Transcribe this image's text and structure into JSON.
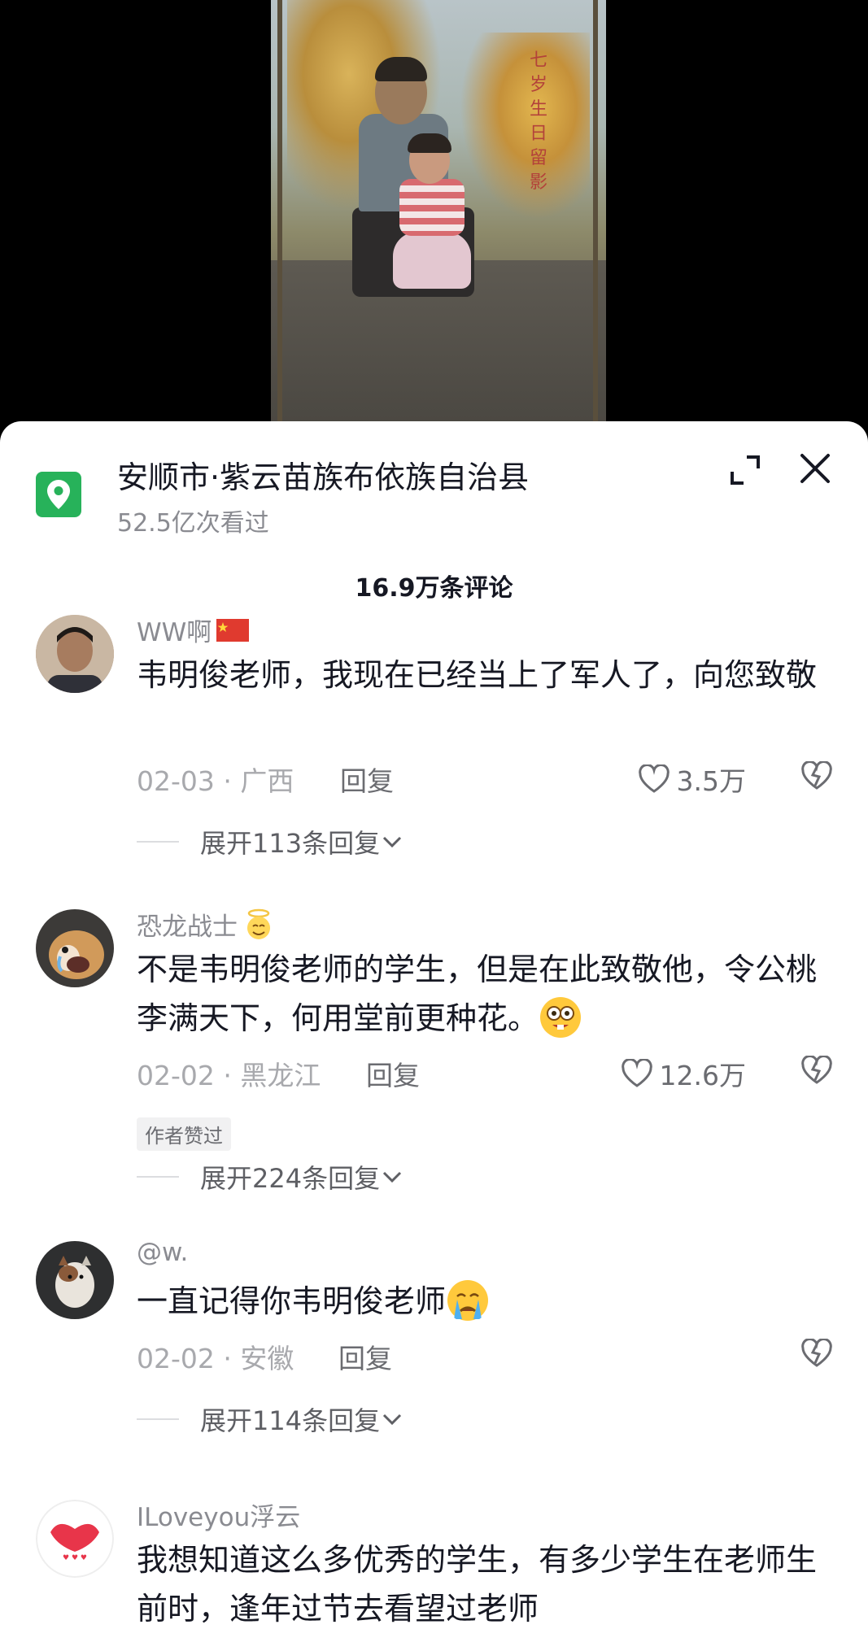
{
  "location": {
    "title": "安顺市·紫云苗族布依族自治县",
    "views": "52.5亿次看过"
  },
  "comment_count": "16.9万条评论",
  "comments": [
    {
      "username": "WW啊",
      "text": "韦明俊老师，我现在已经当上了军人了，向您致敬",
      "date_region": "02-03 · 广西",
      "reply_label": "回复",
      "likes": "3.5万",
      "expand_label": "展开113条回复"
    },
    {
      "username": "恐龙战士",
      "text": "不是韦明俊老师的学生，但是在此致敬他，令公桃李满天下，何用堂前更种花。",
      "date_region": "02-02 · 黑龙江",
      "reply_label": "回复",
      "likes": "12.6万",
      "badge": "作者赞过",
      "expand_label": "展开224条回复"
    },
    {
      "username": "@w.",
      "text": "一直记得你韦明俊老师",
      "date_region": "02-02 · 安徽",
      "reply_label": "回复",
      "expand_label": "展开114条回复"
    },
    {
      "username": "ILoveyou浮云",
      "text": "我想知道这么多优秀的学生，有多少学生在老师生前时，逢年过节去看望过老师"
    }
  ],
  "photo_inscription": "七岁生日留影",
  "icons": {
    "location": "location-pin-icon",
    "expand": "expand-icon",
    "close": "close-icon",
    "like": "heart-icon",
    "dislike": "broken-heart-icon",
    "chevron": "chevron-down-icon"
  },
  "colors": {
    "accent_green": "#27b25a",
    "text_primary": "#161823",
    "text_secondary": "#8a8b91"
  }
}
